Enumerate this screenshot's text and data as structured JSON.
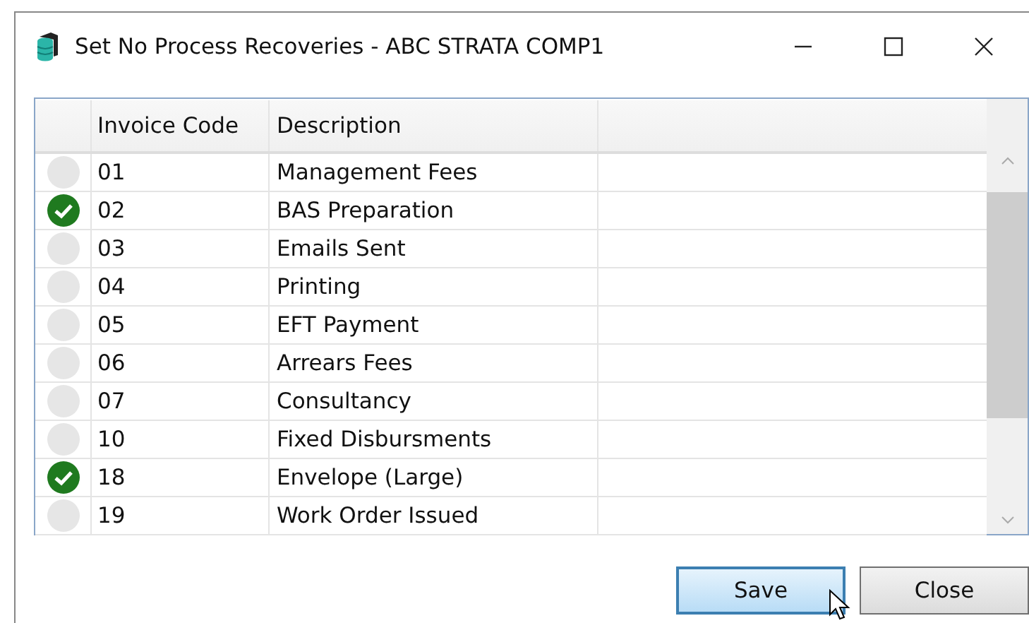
{
  "window": {
    "title": "Set No Process Recoveries - ABC STRATA COMP1"
  },
  "table": {
    "columns": [
      "Invoice Code",
      "Description"
    ],
    "rows": [
      {
        "code": "01",
        "description": "Management Fees",
        "checked": false
      },
      {
        "code": "02",
        "description": "BAS Preparation",
        "checked": true
      },
      {
        "code": "03",
        "description": "Emails Sent",
        "checked": false
      },
      {
        "code": "04",
        "description": "Printing",
        "checked": false
      },
      {
        "code": "05",
        "description": "EFT Payment",
        "checked": false
      },
      {
        "code": "06",
        "description": "Arrears Fees",
        "checked": false
      },
      {
        "code": "07",
        "description": "Consultancy",
        "checked": false
      },
      {
        "code": "10",
        "description": "Fixed Disbursments",
        "checked": false
      },
      {
        "code": "18",
        "description": "Envelope (Large)",
        "checked": true
      },
      {
        "code": "19",
        "description": "Work Order Issued",
        "checked": false
      }
    ]
  },
  "buttons": [
    {
      "label": "Save",
      "focused": true
    },
    {
      "label": "Close",
      "focused": false
    }
  ]
}
